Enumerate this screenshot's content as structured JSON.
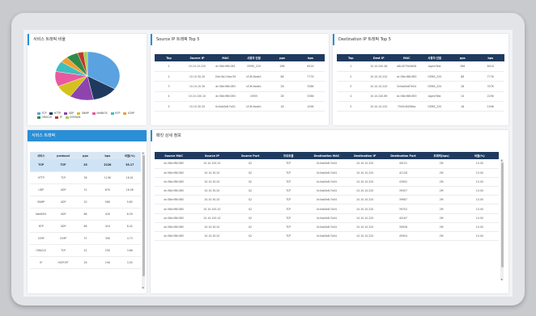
{
  "pie_panel": {
    "title": "서비스 트래픽 비율"
  },
  "chart_data": {
    "type": "pie",
    "slices": [
      {
        "label": "TCP",
        "value": 0.34,
        "color": "#5aa2e0"
      },
      {
        "label": "HTTP",
        "value": 0.13,
        "color": "#1f3a5e"
      },
      {
        "label": "UDP",
        "value": 0.12,
        "color": "#8e44ad"
      },
      {
        "label": "SNMP",
        "value": 0.09,
        "color": "#d4c11f"
      },
      {
        "label": "NetBIOS",
        "value": 0.1,
        "color": "#e85aa0"
      },
      {
        "label": "NTP",
        "value": 0.07,
        "color": "#3fbfbf"
      },
      {
        "label": "ICMP",
        "value": 0.04,
        "color": "#f0a030"
      },
      {
        "label": "ORACLE",
        "value": 0.06,
        "color": "#2f8a4a"
      },
      {
        "label": "IP",
        "value": 0.03,
        "color": "#c0392b"
      },
      {
        "label": "DOMAIN",
        "value": 0.02,
        "color": "#a0d060"
      }
    ]
  },
  "src_panel": {
    "title": "Source IP 트래픽 Top 5",
    "headers": [
      "Top",
      "Source IP",
      "MAC",
      "사용자 단말",
      "pps",
      "bps"
    ],
    "rows": [
      [
        "1",
        "10.10.10.220",
        "dc:58e:f86:0B1",
        "OEMS_220",
        "286",
        "841K"
      ],
      [
        "2",
        "10.10.30.20",
        "00e:0b1:0ba:59",
        "UCM-Node1",
        "86",
        "777K"
      ],
      [
        "3",
        "10.10.10.30",
        "dc:58e:f86:0B3",
        "UCM-Node1",
        "28",
        "338K"
      ],
      [
        "4",
        "10.10.100.10",
        "dc:58e:f86:0B3",
        "CMS5",
        "28",
        "338K"
      ],
      [
        "5",
        "10.10.30.20",
        "0c0ab0e8:7a01",
        "UCM-Node1",
        "18",
        "109K"
      ]
    ]
  },
  "dst_panel": {
    "title": "Destination IP 트래픽 Top 5",
    "headers": [
      "Top",
      "Dest IP",
      "MAC",
      "사용자 단말",
      "pps",
      "bps"
    ],
    "rows": [
      [
        "1",
        "10.10.240.48",
        "d8c4075d4606",
        "AgentTest",
        "286",
        "841K"
      ],
      [
        "2",
        "10.10.10.220",
        "dc:58e:f86:0B5",
        "OEMS_220",
        "86",
        "777K"
      ],
      [
        "3",
        "10.10.10.220",
        "0c0ab0e87e04",
        "OEMS_220",
        "28",
        "337K"
      ],
      [
        "4",
        "10.10.240.69",
        "dc:58e:f86:0B3",
        "AgentTest",
        "24",
        "225K"
      ],
      [
        "5",
        "10.10.10.220",
        "7505c6456fac",
        "OEMS_220",
        "18",
        "194K"
      ]
    ]
  },
  "svc_panel": {
    "title": "서비스 트래픽",
    "headers": [
      "서비스",
      "protocol",
      "pps",
      "bps",
      "비율(%)"
    ],
    "rows": [
      [
        "TCP",
        "TCP",
        "25",
        "222K",
        "35.17"
      ],
      [
        "HTTP",
        "TCP",
        "36",
        "119K",
        "18.01"
      ],
      [
        "UDP",
        "UDP",
        "31",
        "87K",
        "16.56"
      ],
      [
        "SNMP",
        "UDP",
        "20",
        "56K",
        "9.85"
      ],
      [
        "NetBIOS",
        "UDP",
        "88",
        "42K",
        "8.59"
      ],
      [
        "NTP",
        "UDP",
        "86",
        "41K",
        "8.42"
      ],
      [
        "ICMP",
        "ICMP",
        "37",
        "30K",
        "4.73"
      ],
      [
        "ORACLE",
        "TCP",
        "52",
        "25K",
        "3.86"
      ],
      [
        "IP",
        "HOPOPT",
        "26",
        "19K",
        "3.05"
      ]
    ]
  },
  "detail_panel": {
    "title": "패킷 상세 정보",
    "headers": [
      "Source MAC",
      "Source IP",
      "Source Port",
      "프로토콜",
      "Destination MAC",
      "Destination IP",
      "Destination Port",
      "트래픽(bps)",
      "비율(%)"
    ],
    "rows": [
      [
        "dc:58e:f86:0B3",
        "10.10.100.10",
        "$2",
        "TCP",
        "0c0ab0e8:7a04",
        "10.10.10.220",
        "49151",
        "2M",
        "10.00"
      ],
      [
        "dc:58e:f86:0B3",
        "10.10.30.20",
        "$2",
        "TCP",
        "0c0ab0e8:7a04",
        "10.10.10.220",
        "41128",
        "2M",
        "10.00"
      ],
      [
        "dc:58e:f86:0B3",
        "10.10.30.20",
        "$2",
        "TCP",
        "0c0ab0e8:7a04",
        "10.10.10.220",
        "43902",
        "2M",
        "10.00"
      ],
      [
        "dc:58e:f86:0B3",
        "10.10.30.20",
        "$2",
        "TCP",
        "0c0ab0e8:7a04",
        "10.10.10.220",
        "39457",
        "2M",
        "10.00"
      ],
      [
        "dc:58e:f86:0B3",
        "10.10.30.20",
        "$2",
        "TCP",
        "0c0ab0e8:7a04",
        "10.10.10.220",
        "39987",
        "2M",
        "10.00"
      ],
      [
        "dc:58e:f86:0B3",
        "10.10.100.10",
        "$2",
        "TCP",
        "0c0ab0e8:7a04",
        "10.10.10.220",
        "39702",
        "2M",
        "10.00"
      ],
      [
        "dc:58e:f86:0B3",
        "10.10.100.10",
        "$2",
        "TCP",
        "0c0ab0e8:7a04",
        "10.10.10.220",
        "40167",
        "2M",
        "10.00"
      ],
      [
        "dc:58e:f86:0B3",
        "10.10.30.20",
        "$2",
        "TCP",
        "0c0ab0e8:7a04",
        "10.10.10.220",
        "39928",
        "2M",
        "10.00"
      ],
      [
        "dc:58e:f86:0B3",
        "10.10.30.20",
        "$2",
        "TCP",
        "0c0ab0e8:7a04",
        "10.10.10.220",
        "45954",
        "2M",
        "10.00"
      ]
    ]
  }
}
